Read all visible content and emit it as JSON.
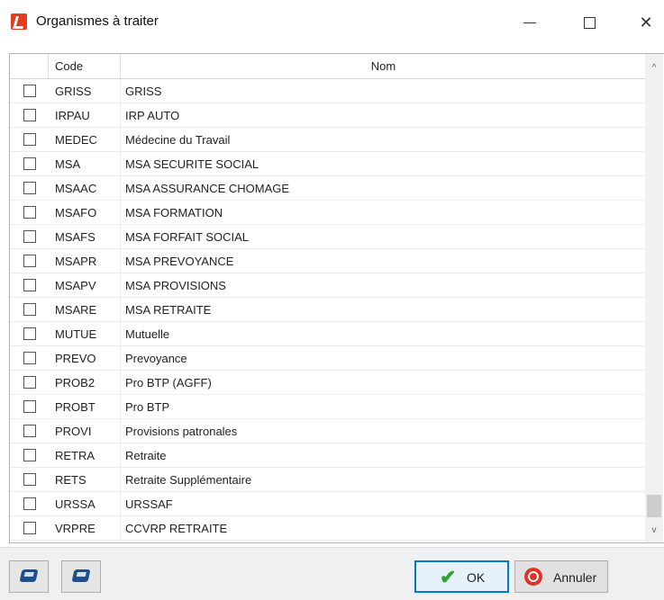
{
  "window": {
    "title": "Organismes à traiter"
  },
  "controls": {
    "minimize": "—",
    "maximize": "☐",
    "close": "✕"
  },
  "table": {
    "columns": {
      "code": "Code",
      "nom": "Nom"
    },
    "rows": [
      {
        "code": "GRISS",
        "nom": "GRISS",
        "checked": false
      },
      {
        "code": "IRPAU",
        "nom": "IRP AUTO",
        "checked": false
      },
      {
        "code": "MEDEC",
        "nom": "Médecine du Travail",
        "checked": false
      },
      {
        "code": "MSA",
        "nom": "MSA SECURITE SOCIAL",
        "checked": false
      },
      {
        "code": "MSAAC",
        "nom": "MSA ASSURANCE CHOMAGE",
        "checked": false
      },
      {
        "code": "MSAFO",
        "nom": "MSA FORMATION",
        "checked": false
      },
      {
        "code": "MSAFS",
        "nom": "MSA FORFAIT SOCIAL",
        "checked": false
      },
      {
        "code": "MSAPR",
        "nom": "MSA PREVOYANCE",
        "checked": false
      },
      {
        "code": "MSAPV",
        "nom": "MSA PROVISIONS",
        "checked": false
      },
      {
        "code": "MSARE",
        "nom": "MSA RETRAITE",
        "checked": false
      },
      {
        "code": "MUTUE",
        "nom": "Mutuelle",
        "checked": false
      },
      {
        "code": "PREVO",
        "nom": "Prevoyance",
        "checked": false
      },
      {
        "code": "PROB2",
        "nom": "Pro BTP (AGFF)",
        "checked": false
      },
      {
        "code": "PROBT",
        "nom": "Pro BTP",
        "checked": false
      },
      {
        "code": "PROVI",
        "nom": "Provisions patronales",
        "checked": false
      },
      {
        "code": "RETRA",
        "nom": "Retraite",
        "checked": false
      },
      {
        "code": "RETS",
        "nom": "Retraite Supplémentaire",
        "checked": false
      },
      {
        "code": "URSSA",
        "nom": "URSSAF",
        "checked": false
      },
      {
        "code": "VRPRE",
        "nom": "CCVRP RETRAITE",
        "checked": false
      }
    ]
  },
  "scrollbar": {
    "up": "^",
    "down": "v"
  },
  "footer": {
    "icon_buttons": [
      "select-all-icon",
      "deselect-all-icon"
    ],
    "ok_label": "OK",
    "cancel_label": "Annuler"
  }
}
